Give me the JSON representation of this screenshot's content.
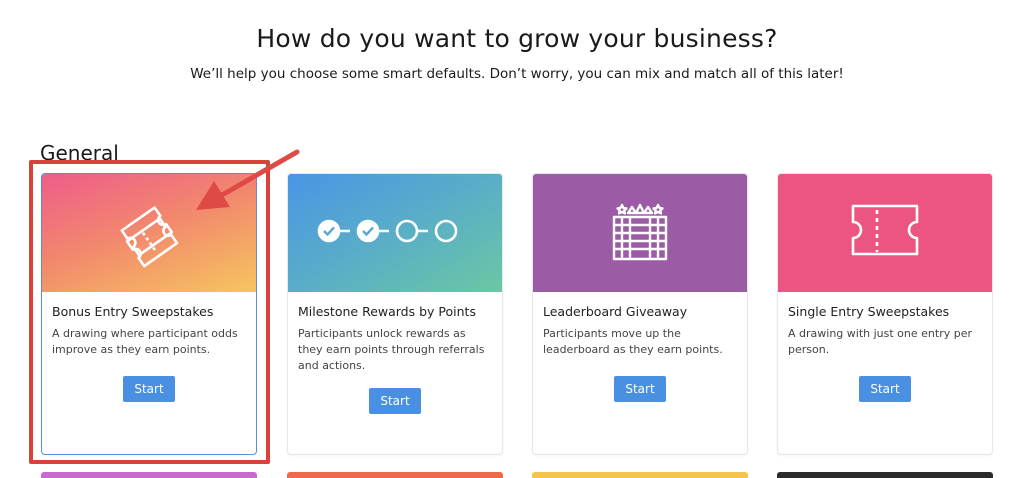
{
  "header": {
    "title": "How do you want to grow your business?",
    "subtitle": "We’ll help you choose some smart defaults. Don’t worry, you can mix and match all of this later!"
  },
  "section": {
    "title": "General"
  },
  "cards": [
    {
      "title": "Bonus Entry Sweepstakes",
      "description": "A drawing where participant odds improve as they earn points.",
      "button": "Start",
      "icon": "tickets-icon",
      "gradient": [
        "#ee5d8a",
        "#f6c55f"
      ]
    },
    {
      "title": "Milestone Rewards by Points",
      "description": "Participants unlock rewards as they earn points through referrals and actions.",
      "button": "Start",
      "icon": "milestones-icon",
      "gradient": [
        "#4a95e6",
        "#6cc7a3"
      ]
    },
    {
      "title": "Leaderboard Giveaway",
      "description": "Participants move up the leaderboard as they earn points.",
      "button": "Start",
      "icon": "leaderboard-icon",
      "color": "#9b5ba5"
    },
    {
      "title": "Single Entry Sweepstakes",
      "description": "A drawing with just one entry per person.",
      "button": "Start",
      "icon": "ticket-icon",
      "color": "#ec5482"
    }
  ],
  "colors": {
    "button": "#4a90e2",
    "highlight": "#d9413b",
    "selected_border": "#5a8fd1"
  }
}
